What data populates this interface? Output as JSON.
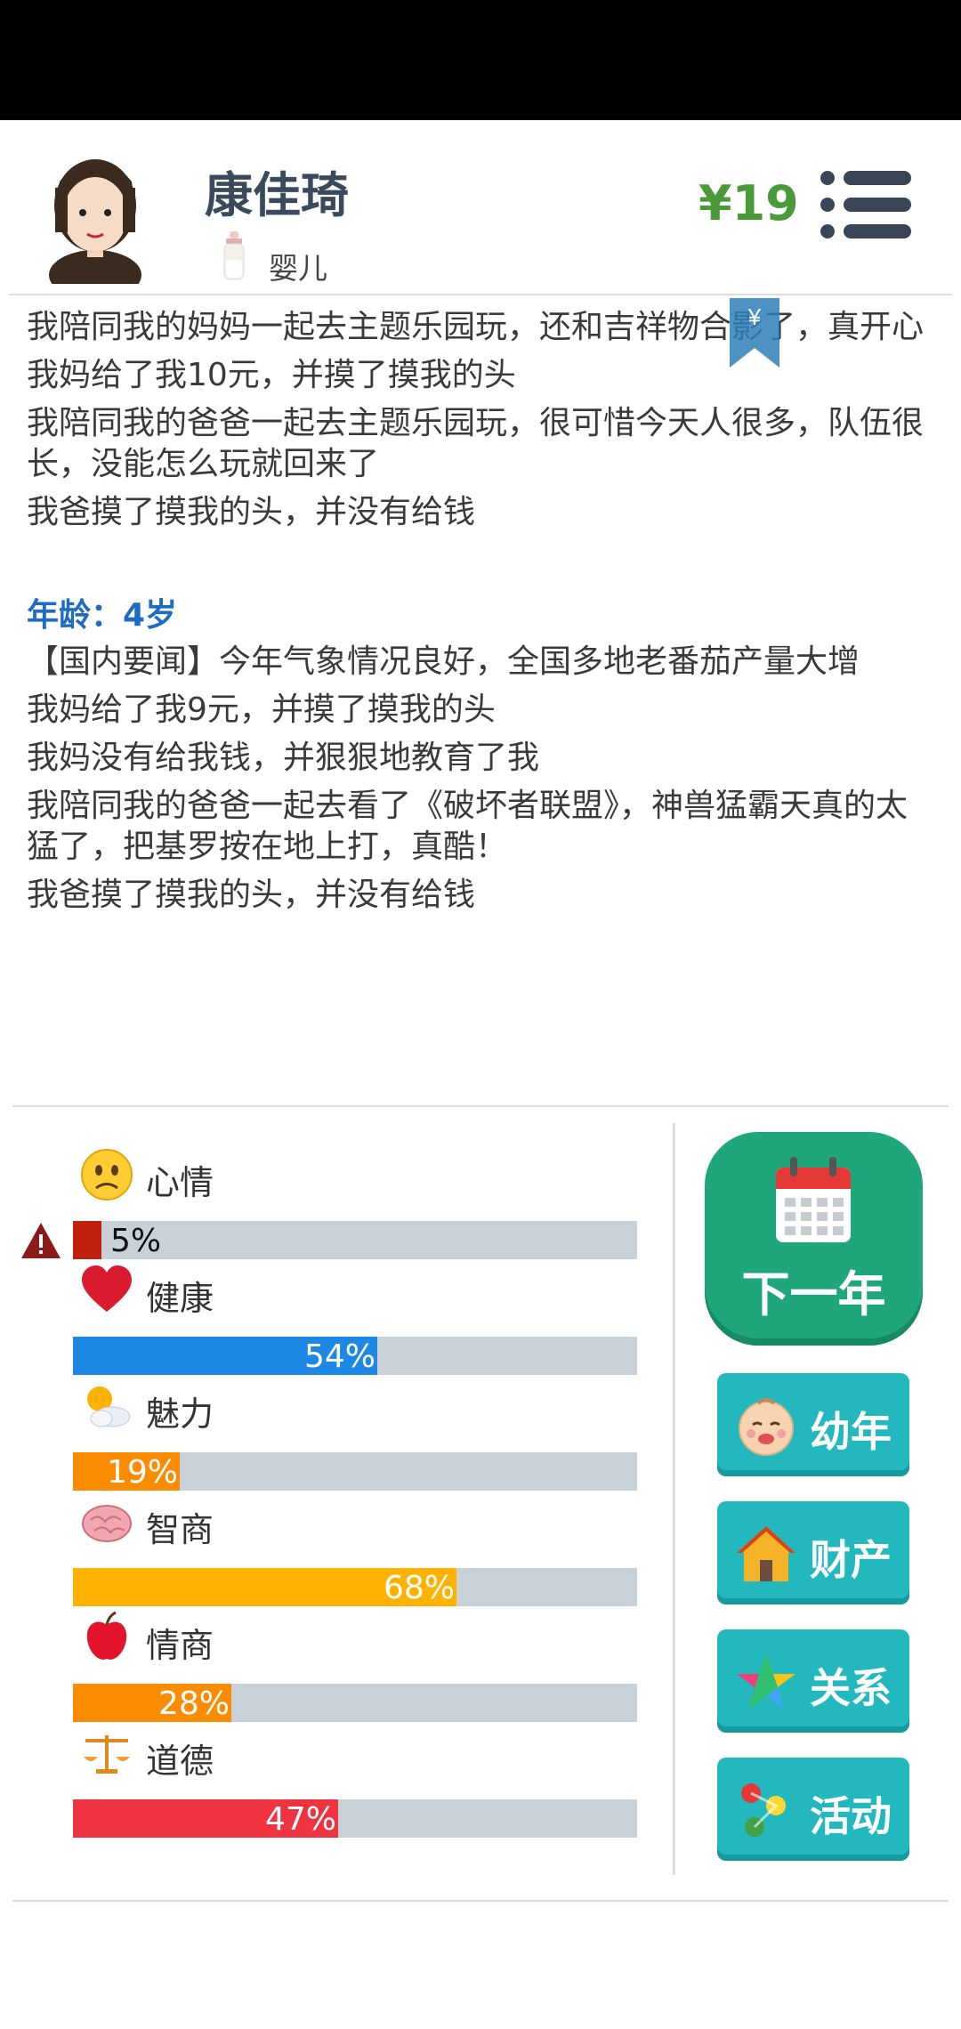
{
  "profile": {
    "name": "康佳琦",
    "stage": "婴儿",
    "money": "¥19"
  },
  "bookmark": {
    "symbol": "¥"
  },
  "log": {
    "lines_before": [
      "我陪同我的妈妈一起去主题乐园玩，还和吉祥物合影了，真开心",
      "我妈给了我10元，并摸了摸我的头",
      "我陪同我的爸爸一起去主题乐园玩，很可惜今天人很多，队伍很长，没能怎么玩就回来了",
      "我爸摸了摸我的头，并没有给钱"
    ],
    "age_heading": "年龄：4岁",
    "lines_after": [
      "【国内要闻】今年气象情况良好，全国多地老番茄产量大增",
      "我妈给了我9元，并摸了摸我的头",
      "我妈没有给我钱，并狠狠地教育了我",
      "我陪同我的爸爸一起去看了《破坏者联盟》，神兽猛霸天真的太猛了，把基罗按在地上打，真酷！",
      "我爸摸了摸我的头，并没有给钱"
    ]
  },
  "stats": [
    {
      "key": "mood",
      "label": "心情",
      "value": 5,
      "text": "5%",
      "color": "#c0200e",
      "icon": "sad-face-icon",
      "warning": true
    },
    {
      "key": "health",
      "label": "健康",
      "value": 54,
      "text": "54%",
      "color": "#1e88e5",
      "icon": "heart-icon",
      "warning": false
    },
    {
      "key": "charm",
      "label": "魅力",
      "value": 19,
      "text": "19%",
      "color": "#fb8c00",
      "icon": "sun-cloud-icon",
      "warning": false
    },
    {
      "key": "iq",
      "label": "智商",
      "value": 68,
      "text": "68%",
      "color": "#ffb300",
      "icon": "brain-icon",
      "warning": false
    },
    {
      "key": "eq",
      "label": "情商",
      "value": 28,
      "text": "28%",
      "color": "#fb8c00",
      "icon": "apple-icon",
      "warning": false
    },
    {
      "key": "morality",
      "label": "道德",
      "value": 47,
      "text": "47%",
      "color": "#ef3340",
      "icon": "scales-icon",
      "warning": false
    }
  ],
  "actions": {
    "next_year": "下一年",
    "childhood": "幼年",
    "assets": "财产",
    "relations": "关系",
    "activities": "活动"
  }
}
